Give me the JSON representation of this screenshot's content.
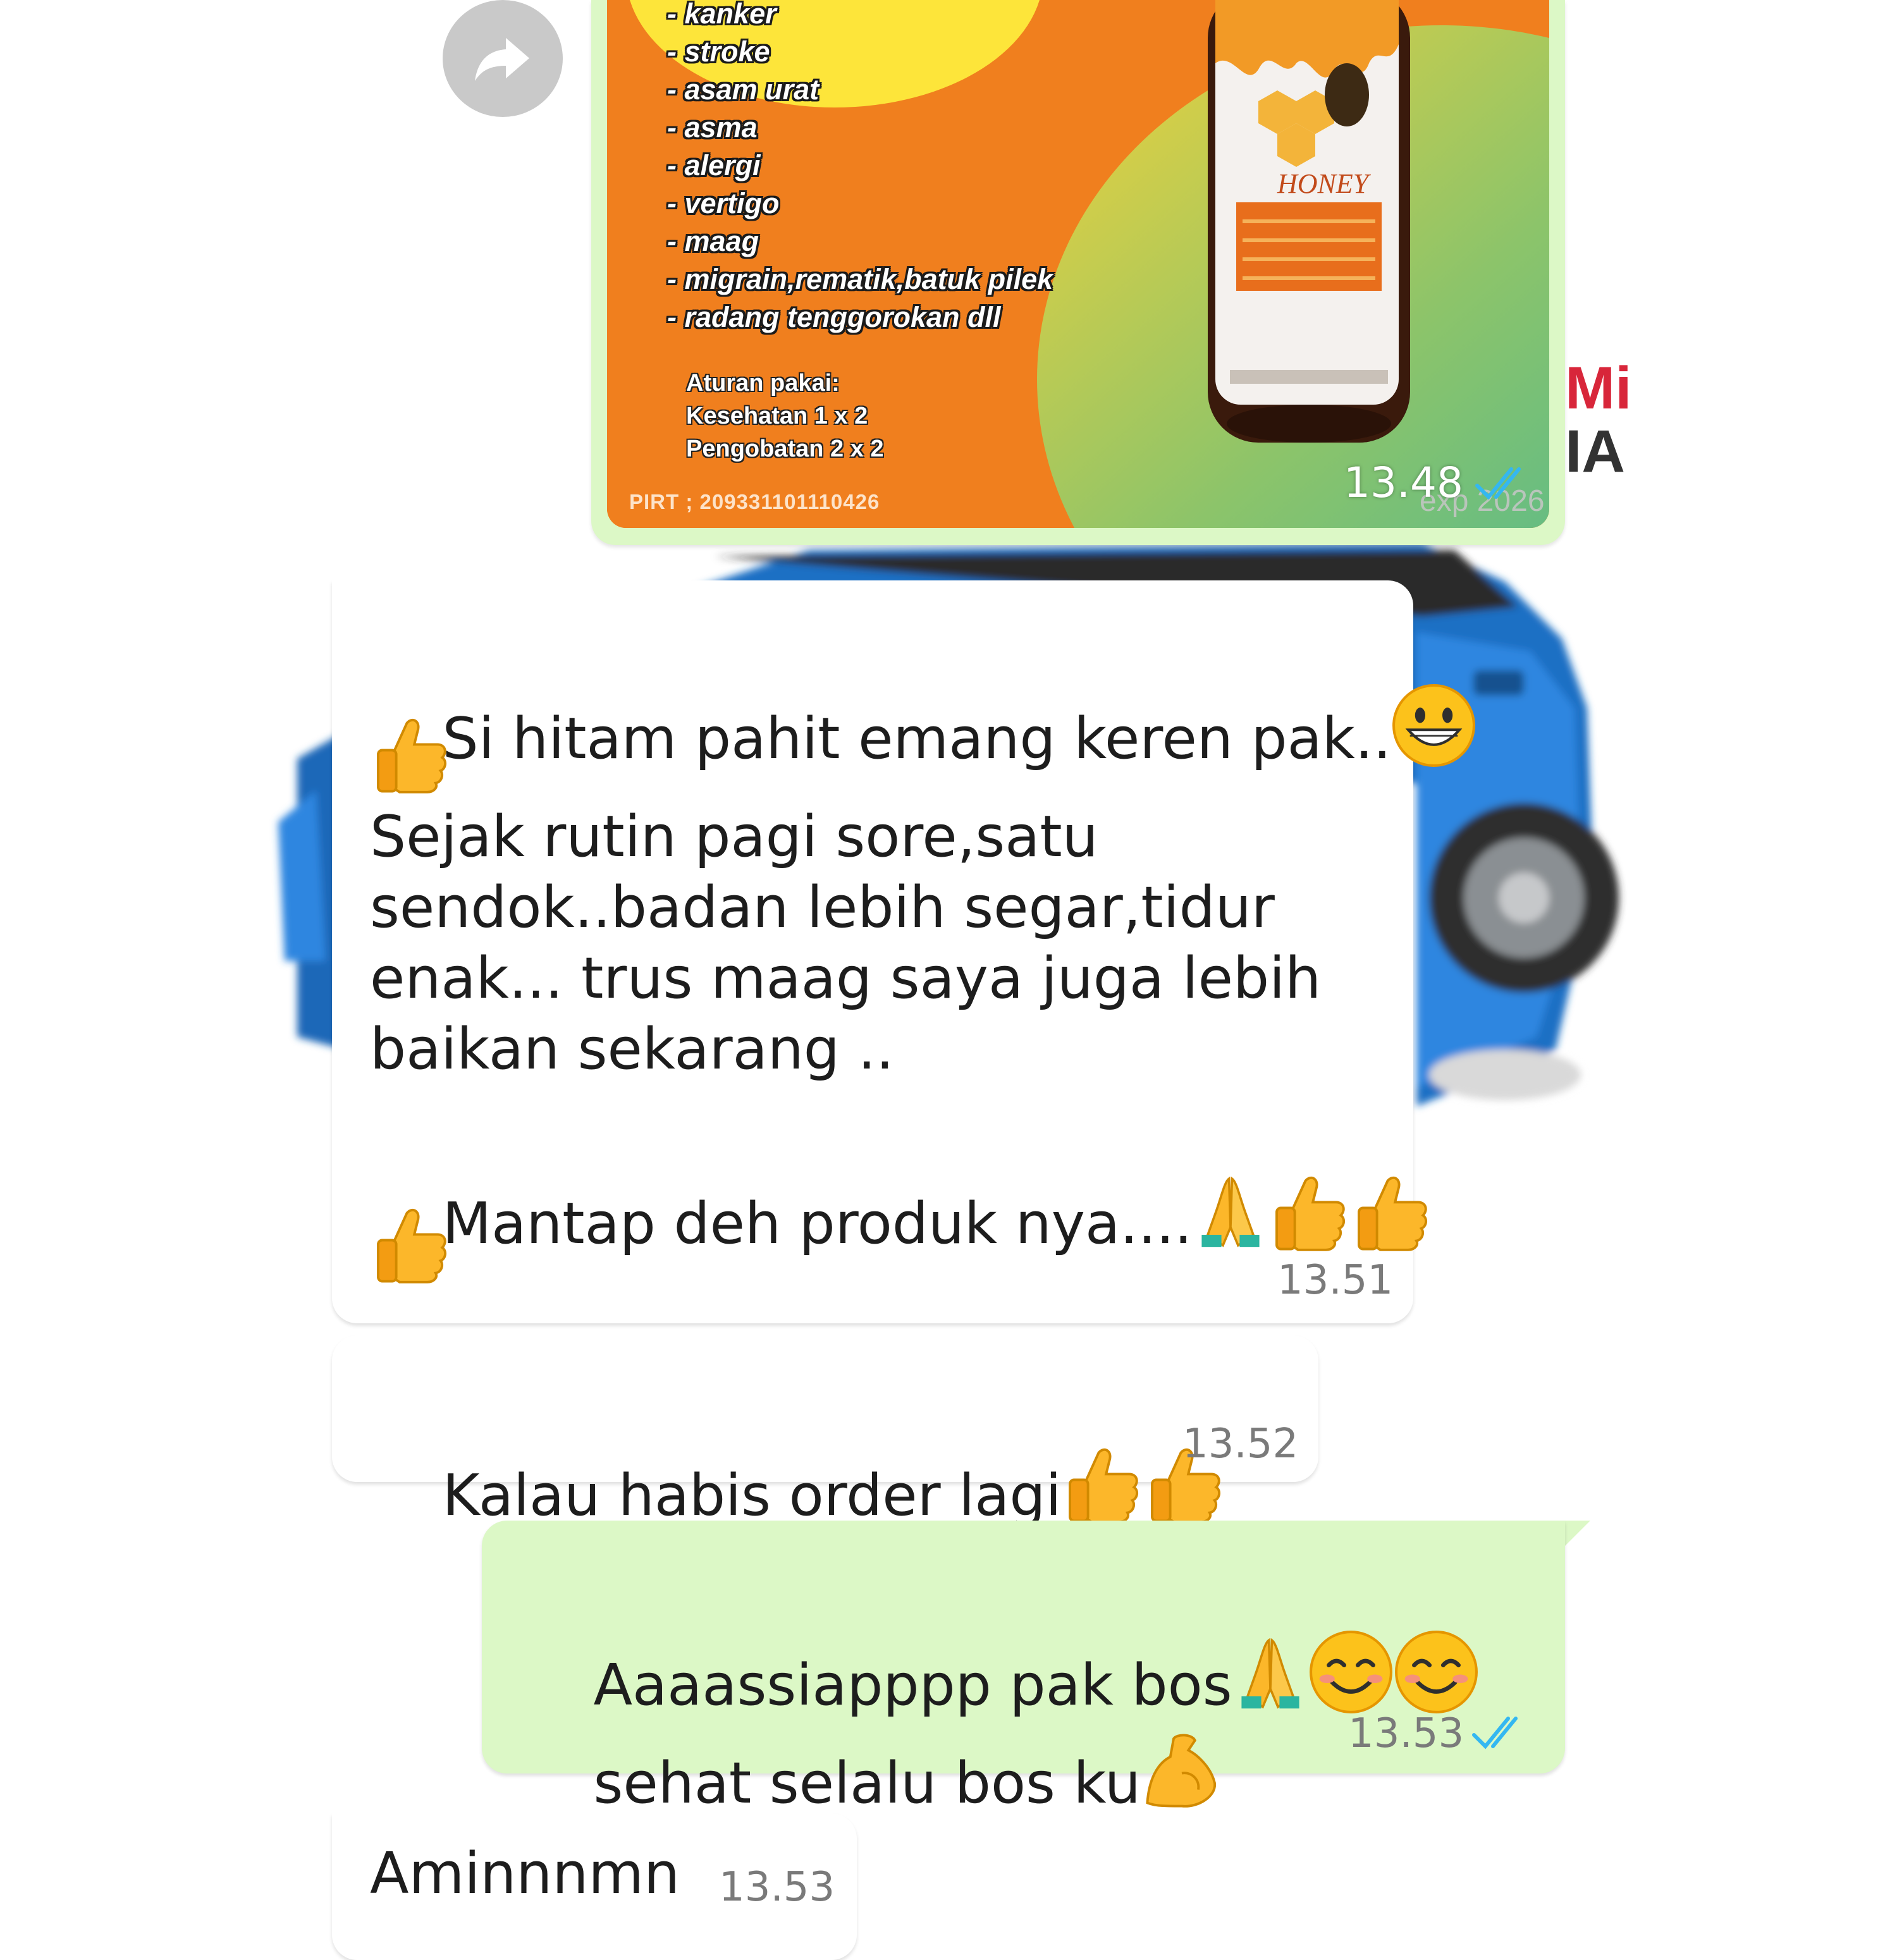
{
  "image_message": {
    "benefits": [
      "kanker",
      "stroke",
      "asam urat",
      "asma",
      "alergi",
      "vertigo",
      "maag",
      "migrain,rematik,batuk pilek",
      "radang tenggorokan dll"
    ],
    "usage_title": "Aturan pakai:",
    "usage_health": "Kesehatan 1 x 2",
    "usage_treatment": "Pengobatan 2 x 2",
    "pirt": "PIRT ; 209331101110426",
    "expiry": "exp 2026",
    "bottle_label": "HONEY",
    "time": "13.48"
  },
  "messages": [
    {
      "direction": "in",
      "line1": "Si hitam pahit emang keren pak..",
      "line2": "Sejak rutin pagi sore,satu",
      "line3": "sendok..badan lebih segar,tidur",
      "line4": "enak... trus maag saya juga lebih",
      "line5": "baikan sekarang ..",
      "line6": "Mantap deh produk nya....",
      "time": "13.51"
    },
    {
      "direction": "in",
      "text": "Kalau habis order lagi",
      "time": "13.52"
    },
    {
      "direction": "out",
      "line1": "Aaaassiapppp pak bos",
      "line2": "sehat selalu bos ku",
      "time": "13.53"
    },
    {
      "direction": "in",
      "text": "Aminnnmn",
      "time": "13.53"
    }
  ],
  "watermark": {
    "line1": "Mi",
    "line2": "IA"
  },
  "icons": {
    "forward": "forward-arrow-icon",
    "read": "double-check-icon",
    "emoji_grin": "grinning-face-emoji",
    "emoji_thumbs": "thumbs-up-emoji",
    "emoji_pray": "folded-hands-emoji",
    "emoji_smile": "smiling-face-emoji",
    "emoji_muscle": "flexed-biceps-emoji"
  },
  "colors": {
    "incoming_bubble": "#ffffff",
    "outgoing_bubble": "#dcf8c6",
    "read_tick": "#34b7f1",
    "product_orange": "#f07f1e",
    "product_yellow": "#fde53a",
    "product_teal": "#3bb6a0"
  }
}
